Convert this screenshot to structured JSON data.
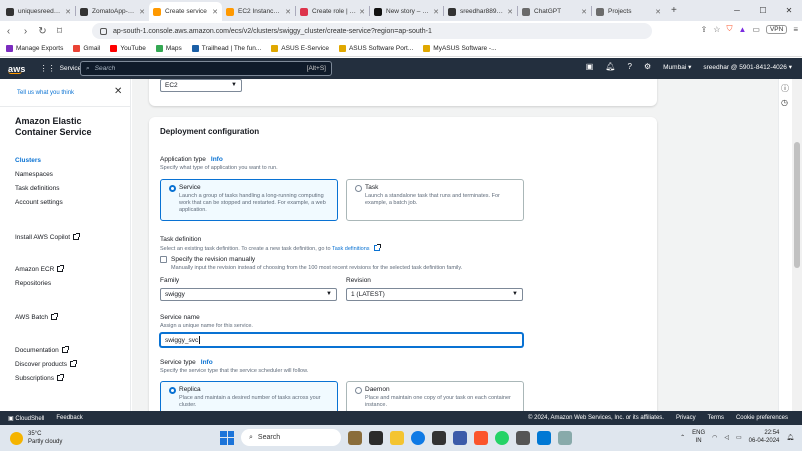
{
  "browser": {
    "tabs": [
      {
        "label": "uniquesreedhar/l",
        "color": "#333333",
        "active": false
      },
      {
        "label": "ZomatoApp-Clon",
        "color": "#333333",
        "active": false
      },
      {
        "label": "Create service",
        "color": "#ff9900",
        "active": true
      },
      {
        "label": "EC2 Instance Cor",
        "color": "#ff9900",
        "active": false
      },
      {
        "label": "Create role | IAM",
        "color": "#dd344c",
        "active": false
      },
      {
        "label": "New story – Medi",
        "color": "#111111",
        "active": false
      },
      {
        "label": "sreedhar8897/sw",
        "color": "#333333",
        "active": false
      },
      {
        "label": "ChatGPT",
        "color": "#6b6b6b",
        "active": false
      },
      {
        "label": "Projects",
        "color": "#6b6b6b",
        "active": false
      }
    ],
    "url": "ap-south-1.console.aws.amazon.com/ecs/v2/clusters/swiggy_cluster/create-service?region=ap-south-1",
    "vpn_label": "VPN",
    "bookmarks": [
      {
        "label": "Manage Exports",
        "color": "#7b2cbf"
      },
      {
        "label": "Gmail",
        "color": "#ea4335"
      },
      {
        "label": "YouTube",
        "color": "#ff0000"
      },
      {
        "label": "Maps",
        "color": "#34a853"
      },
      {
        "label": "Trailhead | The fun...",
        "color": "#1b5fa6"
      },
      {
        "label": "ASUS E-Service",
        "color": "#e0a800"
      },
      {
        "label": "ASUS Software Port...",
        "color": "#e0a800"
      },
      {
        "label": "MyASUS Software -...",
        "color": "#e0a800"
      }
    ]
  },
  "aws_nav": {
    "logo": "aws",
    "services": "Services",
    "search_placeholder": "Search",
    "search_shortcut": "[Alt+S]",
    "region": "Mumbai",
    "account": "sreedhar @ 5901-8412-4026"
  },
  "sidebar": {
    "tell_us": "Tell us what you think",
    "title": "Amazon Elastic Container Service",
    "links": [
      {
        "label": "Clusters",
        "active": true,
        "external": false
      },
      {
        "label": "Namespaces",
        "active": false,
        "external": false
      },
      {
        "label": "Task definitions",
        "active": false,
        "external": false
      },
      {
        "label": "Account settings",
        "active": false,
        "external": false
      },
      {
        "label": "Install AWS Copilot",
        "active": false,
        "external": true
      },
      {
        "label": "Amazon ECR",
        "active": false,
        "external": true
      },
      {
        "label": "Repositories",
        "active": false,
        "external": false
      },
      {
        "label": "AWS Batch",
        "active": false,
        "external": true
      },
      {
        "label": "Documentation",
        "active": false,
        "external": true
      },
      {
        "label": "Discover products",
        "active": false,
        "external": true
      },
      {
        "label": "Subscriptions",
        "active": false,
        "external": true
      }
    ]
  },
  "form": {
    "top_select": "EC2",
    "section_title": "Deployment configuration",
    "app_type": {
      "label": "Application type",
      "info": "Info",
      "desc": "Specify what type of application you want to run.",
      "options": [
        {
          "title": "Service",
          "desc": "Launch a group of tasks handling a long-running computing work that can be stopped and restarted. For example, a web application.",
          "selected": true
        },
        {
          "title": "Task",
          "desc": "Launch a standalone task that runs and terminates. For example, a batch job.",
          "selected": false
        }
      ]
    },
    "task_def": {
      "label": "Task definition",
      "desc_prefix": "Select an existing task definition. To create a new task definition, go to",
      "desc_link": "Task definitions",
      "manual_label": "Specify the revision manually",
      "manual_desc": "Manually input the revision instead of choosing from the 100 most recent revisions for the selected task definition family.",
      "family_label": "Family",
      "family_value": "swiggy",
      "revision_label": "Revision",
      "revision_value": "1 (LATEST)"
    },
    "service_name": {
      "label": "Service name",
      "desc": "Assign a unique name for this service.",
      "value": "swiggy_svc"
    },
    "service_type": {
      "label": "Service type",
      "info": "Info",
      "desc": "Specify the service type that the service scheduler will follow.",
      "options": [
        {
          "title": "Replica",
          "desc": "Place and maintain a desired number of tasks across your cluster.",
          "selected": true
        },
        {
          "title": "Daemon",
          "desc": "Place and maintain one copy of your task on each container instance.",
          "selected": false
        }
      ]
    }
  },
  "aws_footer": {
    "cloudshell": "CloudShell",
    "feedback": "Feedback",
    "copyright": "© 2024, Amazon Web Services, Inc. or its affiliates.",
    "privacy": "Privacy",
    "terms": "Terms",
    "cookies": "Cookie preferences"
  },
  "taskbar": {
    "temp": "35°C",
    "weather": "Partly cloudy",
    "search": "Search",
    "lang1": "ENG",
    "lang2": "IN",
    "time": "22:54",
    "date": "06-04-2024"
  }
}
